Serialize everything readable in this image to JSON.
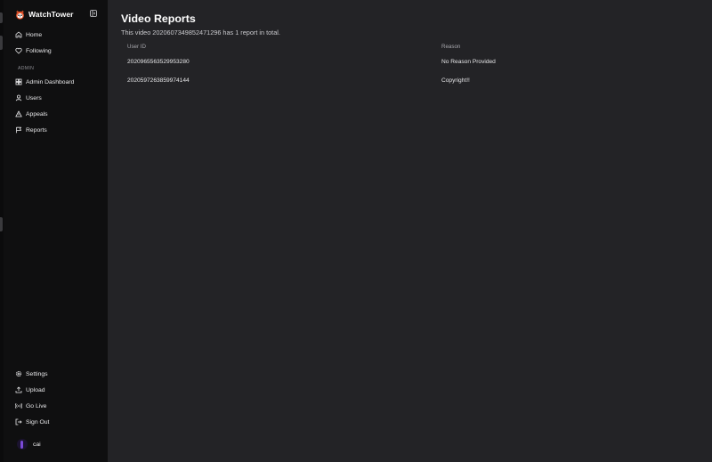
{
  "app": {
    "name": "WatchTower",
    "logo_icon": "red-panda-logo-icon",
    "accent": "#e8542a"
  },
  "sidebar": {
    "nav": [
      {
        "label": "Home",
        "icon": "home-icon"
      },
      {
        "label": "Following",
        "icon": "heart-icon"
      }
    ],
    "admin_section_label": "ADMIN",
    "admin_nav": [
      {
        "label": "Admin Dashboard",
        "icon": "dashboard-icon"
      },
      {
        "label": "Users",
        "icon": "user-icon"
      },
      {
        "label": "Appeals",
        "icon": "warning-icon"
      },
      {
        "label": "Reports",
        "icon": "flag-icon"
      }
    ],
    "bottom_nav": [
      {
        "label": "Settings",
        "icon": "gear-icon"
      },
      {
        "label": "Upload",
        "icon": "upload-icon"
      },
      {
        "label": "Go Live",
        "icon": "broadcast-icon"
      },
      {
        "label": "Sign Out",
        "icon": "sign-out-icon"
      }
    ],
    "user": {
      "name": "cai"
    }
  },
  "main": {
    "title": "Video Reports",
    "subtitle": "This video 2020607349852471296 has 1 report in total.",
    "table": {
      "columns": [
        "User ID",
        "Reason"
      ],
      "rows": [
        {
          "user_id": "2020965563529953280",
          "reason": "No Reason Provided"
        },
        {
          "user_id": "2020597263859974144",
          "reason": "Copyright!!"
        }
      ]
    }
  }
}
